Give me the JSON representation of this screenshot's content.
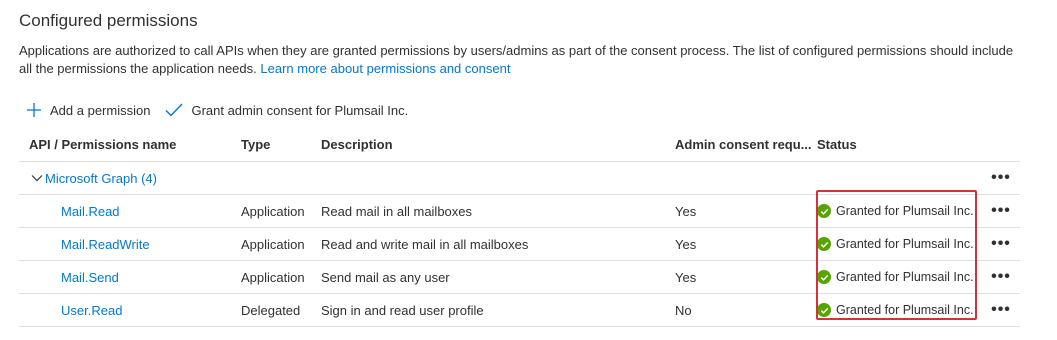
{
  "title": "Configured permissions",
  "description": "Applications are authorized to call APIs when they are granted permissions by users/admins as part of the consent process. The list of configured permissions should include all the permissions the application needs.",
  "learn_more": "Learn more about permissions and consent",
  "toolbar": {
    "add_label": "Add a permission",
    "grant_label": "Grant admin consent for Plumsail Inc."
  },
  "table": {
    "headers": {
      "api": "API / Permissions name",
      "type": "Type",
      "description": "Description",
      "admin": "Admin consent requ...",
      "status": "Status"
    },
    "group": {
      "label": "Microsoft Graph (4)"
    },
    "more": "•••",
    "rows": [
      {
        "name": "Mail.Read",
        "type": "Application",
        "description": "Read mail in all mailboxes",
        "admin": "Yes",
        "status": "Granted for Plumsail Inc."
      },
      {
        "name": "Mail.ReadWrite",
        "type": "Application",
        "description": "Read and write mail in all mailboxes",
        "admin": "Yes",
        "status": "Granted for Plumsail Inc."
      },
      {
        "name": "Mail.Send",
        "type": "Application",
        "description": "Send mail as any user",
        "admin": "Yes",
        "status": "Granted for Plumsail Inc."
      },
      {
        "name": "User.Read",
        "type": "Delegated",
        "description": "Sign in and read user profile",
        "admin": "No",
        "status": "Granted for Plumsail Inc."
      }
    ]
  },
  "colors": {
    "link": "#0078d4",
    "granted": "#57a300",
    "highlight": "#d13438"
  }
}
